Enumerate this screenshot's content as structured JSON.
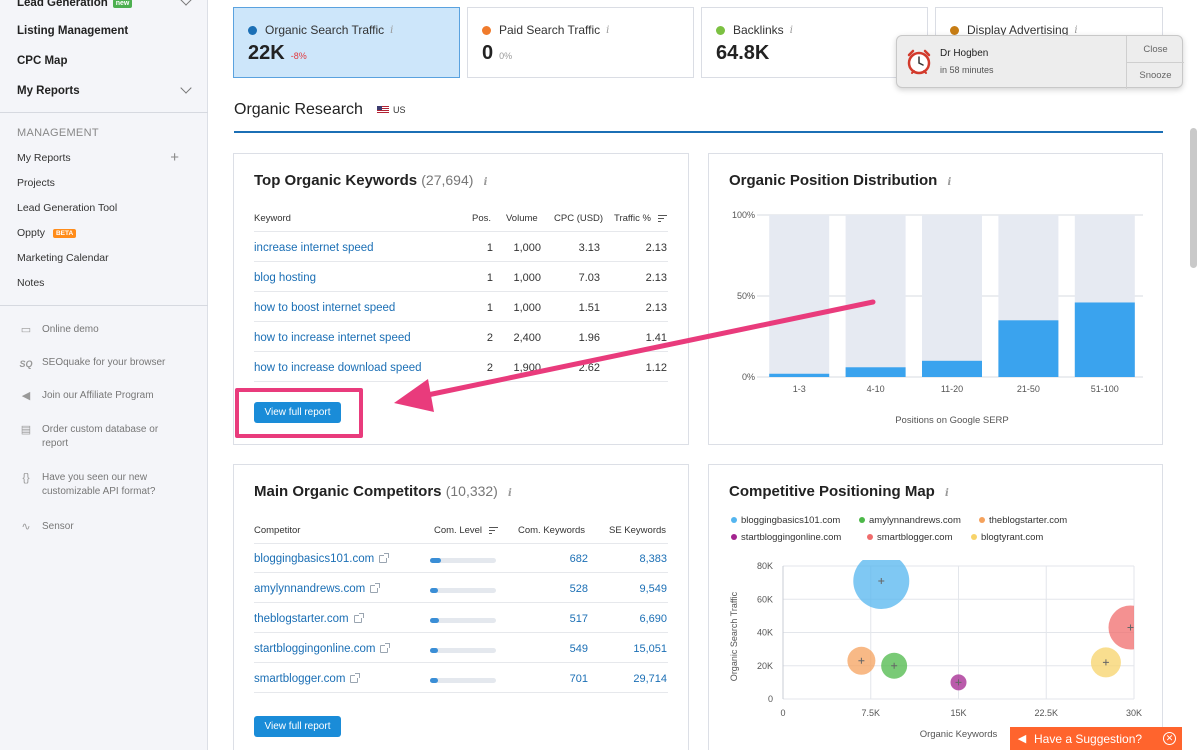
{
  "sidebar": {
    "top_items": [
      {
        "label": "Lead Generation",
        "badge": "new",
        "chevron": true
      },
      {
        "label": "Listing Management"
      },
      {
        "label": "CPC Map"
      },
      {
        "label": "My Reports",
        "chevron": true
      }
    ],
    "management_header": "MANAGEMENT",
    "management_items": [
      {
        "label": "My Reports",
        "plus": "+"
      },
      {
        "label": "Projects"
      },
      {
        "label": "Lead Generation Tool"
      },
      {
        "label": "Oppty",
        "badge": "BETA"
      },
      {
        "label": "Marketing Calendar"
      },
      {
        "label": "Notes"
      }
    ],
    "tools": [
      {
        "icon": "monitor-icon",
        "glyph": "▭",
        "label": "Online demo"
      },
      {
        "icon": "seoquake-icon",
        "glyph": "SQ",
        "label": "SEOquake for your browser"
      },
      {
        "icon": "megaphone-icon",
        "glyph": "◀",
        "label": "Join our Affiliate Program"
      },
      {
        "icon": "document-icon",
        "glyph": "▤",
        "label": "Order custom database or report"
      },
      {
        "icon": "braces-icon",
        "glyph": "{}",
        "label": "Have you seen our new customizable API format?"
      },
      {
        "icon": "pulse-icon",
        "glyph": "∿",
        "label": "Sensor"
      }
    ]
  },
  "metrics": [
    {
      "label": "Organic Search Traffic",
      "value": "22K",
      "delta": "-8%",
      "color": "#1b6fb5",
      "active": true
    },
    {
      "label": "Paid Search Traffic",
      "value": "0",
      "delta": "0%",
      "color": "#f07b2c"
    },
    {
      "label": "Backlinks",
      "value": "64.8K",
      "delta": "",
      "color": "#7cc142"
    },
    {
      "label": "Display Advertising",
      "value": "",
      "delta": "",
      "color": "#c77d14"
    }
  ],
  "notification": {
    "title": "Dr Hogben",
    "subtitle": "in 58 minutes",
    "close": "Close",
    "snooze": "Snooze"
  },
  "section": {
    "title": "Organic Research",
    "region": "US"
  },
  "keywords": {
    "title": "Top Organic Keywords",
    "count": "(27,694)",
    "columns": [
      "Keyword",
      "Pos.",
      "Volume",
      "CPC (USD)",
      "Traffic %"
    ],
    "rows": [
      {
        "keyword": "increase internet speed",
        "pos": "1",
        "volume": "1,000",
        "cpc": "3.13",
        "traffic": "2.13"
      },
      {
        "keyword": "blog hosting",
        "pos": "1",
        "volume": "1,000",
        "cpc": "7.03",
        "traffic": "2.13"
      },
      {
        "keyword": "how to boost internet speed",
        "pos": "1",
        "volume": "1,000",
        "cpc": "1.51",
        "traffic": "2.13"
      },
      {
        "keyword": "how to increase internet speed",
        "pos": "2",
        "volume": "2,400",
        "cpc": "1.96",
        "traffic": "1.41"
      },
      {
        "keyword": "how to increase download speed",
        "pos": "2",
        "volume": "1,900",
        "cpc": "2.62",
        "traffic": "1.12"
      }
    ],
    "button": "View full report"
  },
  "competitors": {
    "title": "Main Organic Competitors",
    "count": "(10,332)",
    "columns": [
      "Competitor",
      "Com. Level",
      "Com. Keywords",
      "SE Keywords"
    ],
    "rows": [
      {
        "domain": "bloggingbasics101.com",
        "level": 0.17,
        "com_keywords": "682",
        "se_keywords": "8,383"
      },
      {
        "domain": "amylynnandrews.com",
        "level": 0.12,
        "com_keywords": "528",
        "se_keywords": "9,549"
      },
      {
        "domain": "theblogstarter.com",
        "level": 0.13,
        "com_keywords": "517",
        "se_keywords": "6,690"
      },
      {
        "domain": "startbloggingonline.com",
        "level": 0.12,
        "com_keywords": "549",
        "se_keywords": "15,051"
      },
      {
        "domain": "smartblogger.com",
        "level": 0.12,
        "com_keywords": "701",
        "se_keywords": "29,714"
      }
    ],
    "button": "View full report"
  },
  "suggestion": {
    "label": "Have a Suggestion?"
  },
  "chart_data": [
    {
      "type": "bar",
      "title": "Organic Position Distribution",
      "xlabel": "Positions on Google SERP",
      "ylabel": "",
      "categories": [
        "1-3",
        "4-10",
        "11-20",
        "21-50",
        "51-100"
      ],
      "values": [
        2,
        6,
        10,
        35,
        46
      ],
      "ylim": [
        0,
        100
      ],
      "yticks": [
        "0%",
        "50%",
        "100%"
      ],
      "color": "#3aa3ee",
      "background_color": "#e6eaf2"
    },
    {
      "type": "scatter",
      "title": "Competitive Positioning Map",
      "xlabel": "Organic Keywords",
      "ylabel": "Organic Search Traffic",
      "xlim": [
        0,
        30000
      ],
      "ylim": [
        0,
        80000
      ],
      "xticks": [
        "0",
        "7.5K",
        "15K",
        "22.5K",
        "30K"
      ],
      "yticks": [
        "0",
        "20K",
        "40K",
        "60K",
        "80K"
      ],
      "legend": "top",
      "series": [
        {
          "name": "bloggingbasics101.com",
          "color": "#54b5ef",
          "x": 8400,
          "y": 71000,
          "size": 28
        },
        {
          "name": "amylynnandrews.com",
          "color": "#4cb848",
          "x": 9500,
          "y": 20000,
          "size": 13
        },
        {
          "name": "theblogstarter.com",
          "color": "#f5a25d",
          "x": 6700,
          "y": 23000,
          "size": 14
        },
        {
          "name": "startbloggingonline.com",
          "color": "#a3248f",
          "x": 15000,
          "y": 10000,
          "size": 8
        },
        {
          "name": "smartblogger.com",
          "color": "#f06c6c",
          "x": 29700,
          "y": 43000,
          "size": 22
        },
        {
          "name": "blogtyrant.com",
          "color": "#f7d36a",
          "x": 27600,
          "y": 22000,
          "size": 15
        }
      ]
    }
  ]
}
